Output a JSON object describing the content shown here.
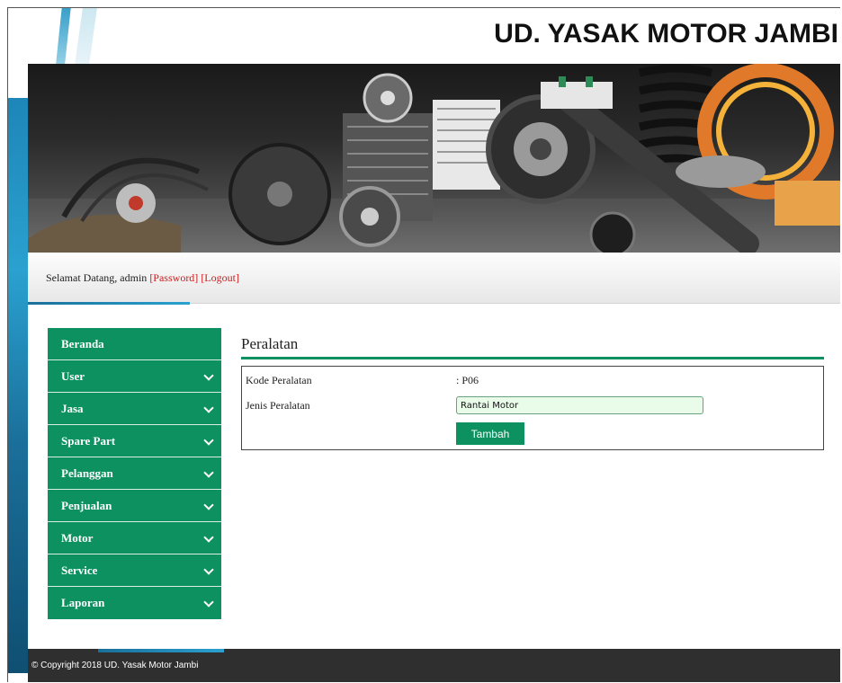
{
  "header": {
    "site_title": "UD. YASAK MOTOR JAMBI"
  },
  "welcome": {
    "greeting": "Selamat Datang, admin ",
    "password_link": "[Password]",
    "logout_link": "[Logout]"
  },
  "sidebar": {
    "items": [
      {
        "label": "Beranda",
        "has_chevron": false
      },
      {
        "label": "User",
        "has_chevron": true
      },
      {
        "label": "Jasa",
        "has_chevron": true
      },
      {
        "label": "Spare Part",
        "has_chevron": true
      },
      {
        "label": "Pelanggan",
        "has_chevron": true
      },
      {
        "label": "Penjualan",
        "has_chevron": true
      },
      {
        "label": "Motor",
        "has_chevron": true
      },
      {
        "label": "Service",
        "has_chevron": true
      },
      {
        "label": "Laporan",
        "has_chevron": true
      }
    ]
  },
  "main": {
    "title": "Peralatan",
    "form": {
      "kode_label": "Kode Peralatan",
      "kode_value": ": P06",
      "jenis_label": "Jenis Peralatan",
      "jenis_value": "Rantai Motor",
      "submit_label": "Tambah"
    }
  },
  "footer": {
    "copyright": "© Copyright 2018 UD. Yasak Motor Jambi"
  },
  "colors": {
    "accent_green": "#0e9160",
    "link_red": "#d11a1a",
    "footer_bg": "#2f2f2f"
  }
}
